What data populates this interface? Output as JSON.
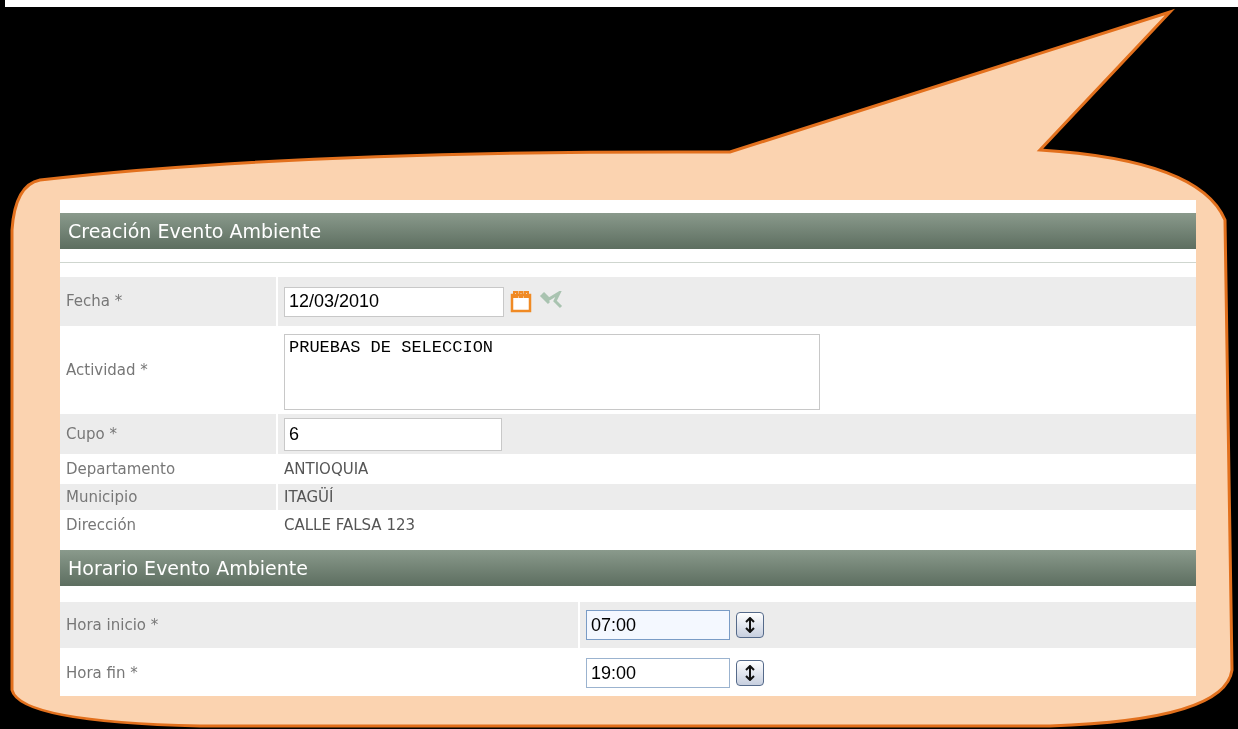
{
  "sections": [
    {
      "title": "Creación Evento Ambiente",
      "rows": [
        {
          "kind": "date",
          "label": "Fecha *",
          "value": "12/03/2010"
        },
        {
          "kind": "textarea",
          "label": "Actividad *",
          "value": "PRUEBAS DE SELECCION"
        },
        {
          "kind": "input",
          "label": "Cupo *",
          "value": "6"
        },
        {
          "kind": "static",
          "label": "Departamento",
          "value": "ANTIOQUIA"
        },
        {
          "kind": "static",
          "label": "Municipio",
          "value": "ITAGÜÍ"
        },
        {
          "kind": "static",
          "label": "Dirección",
          "value": "CALLE FALSA 123"
        }
      ]
    },
    {
      "title": "Horario Evento Ambiente",
      "rows": [
        {
          "kind": "time",
          "label": "Hora inicio *",
          "value": "07:00",
          "focused": true
        },
        {
          "kind": "time",
          "label": "Hora fin *",
          "value": "19:00",
          "focused": false
        }
      ]
    }
  ]
}
